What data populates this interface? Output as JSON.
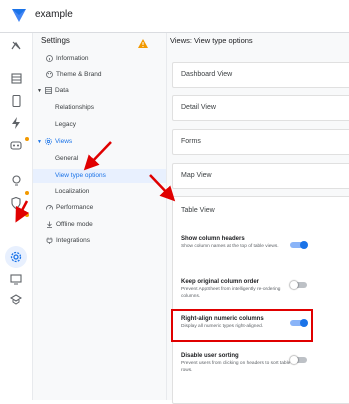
{
  "app": {
    "name": "example"
  },
  "settings": {
    "title": "Settings",
    "items": [
      {
        "label": "Information",
        "icon": "info-icon"
      },
      {
        "label": "Theme & Brand",
        "icon": "palette-icon"
      },
      {
        "label": "Data",
        "icon": "table-icon",
        "expanded": true
      },
      {
        "label": "Relationships"
      },
      {
        "label": "Legacy"
      },
      {
        "label": "Views",
        "icon": "views-icon",
        "expanded": true
      },
      {
        "label": "General"
      },
      {
        "label": "View type options",
        "selected": true
      },
      {
        "label": "Localization"
      },
      {
        "label": "Performance",
        "icon": "speed-icon"
      },
      {
        "label": "Offline mode",
        "icon": "offline-icon"
      },
      {
        "label": "Integrations",
        "icon": "plug-icon"
      }
    ]
  },
  "main": {
    "title": "Views: View type options",
    "sections": [
      {
        "label": "Dashboard View"
      },
      {
        "label": "Detail View"
      },
      {
        "label": "Forms"
      },
      {
        "label": "Map View"
      }
    ],
    "table_view": {
      "label": "Table View",
      "options": [
        {
          "title": "Show column headers",
          "desc": "Show column names at the top of table views.",
          "on": true
        },
        {
          "title": "Keep original column order",
          "desc": "Prevent AppSheet from intelligently re-ordering columns.",
          "on": false
        },
        {
          "title": "Right-align numeric columns",
          "desc": "Display all numeric types right-aligned.",
          "on": true
        },
        {
          "title": "Disable user sorting",
          "desc": "Prevent users from clicking on headers to sort table rows.",
          "on": false
        }
      ]
    }
  },
  "colors": {
    "accent": "#1a73e8",
    "warning": "#f29900",
    "annotation": "#e00000"
  }
}
